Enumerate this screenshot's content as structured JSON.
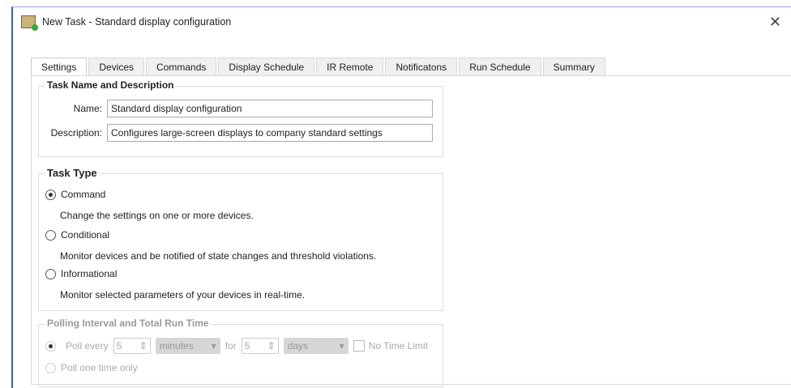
{
  "window": {
    "title": "New Task - Standard display configuration",
    "close": "✕"
  },
  "tabs": [
    "Settings",
    "Devices",
    "Commands",
    "Display Schedule",
    "IR Remote",
    "Notificatons",
    "Run Schedule",
    "Summary"
  ],
  "task_name_group": {
    "title": "Task Name and Description",
    "name_label": "Name:",
    "name_value": "Standard display configuration",
    "desc_label": "Description:",
    "desc_value": "Configures large-screen displays to company standard settings"
  },
  "task_type": {
    "title": "Task Type",
    "options": [
      {
        "label": "Command",
        "description": "Change the settings on one or more devices.",
        "selected": true
      },
      {
        "label": "Conditional",
        "description": "Monitor devices and be notified of state changes and threshold violations.",
        "selected": false
      },
      {
        "label": "Informational",
        "description": "Monitor selected parameters of your devices in real-time.",
        "selected": false
      }
    ]
  },
  "polling": {
    "title": "Polling Interval and Total Run Time",
    "poll_every_label": "Poll every",
    "interval_value": "5",
    "interval_unit": "minutes",
    "for_label": "for",
    "duration_value": "5",
    "duration_unit": "days",
    "no_limit_label": "No Time Limit",
    "poll_once_label": "Poll one time only"
  }
}
